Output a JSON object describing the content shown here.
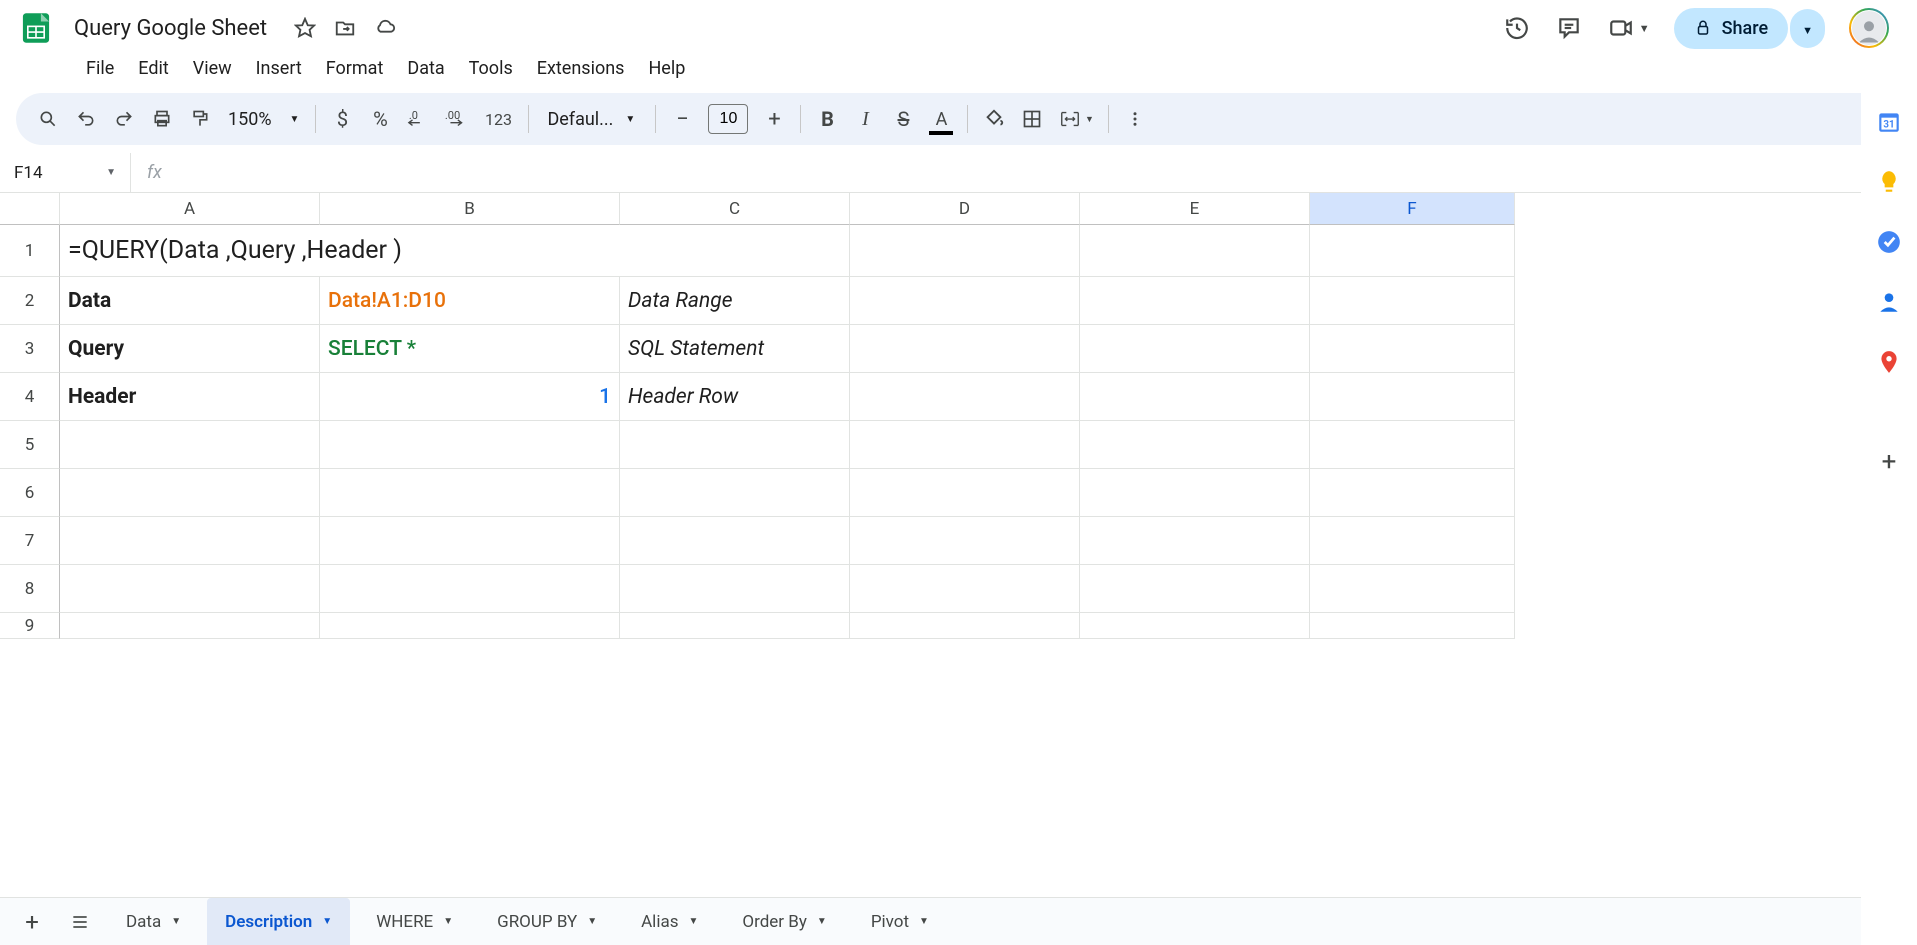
{
  "doc": {
    "title": "Query Google Sheet"
  },
  "menu": [
    "File",
    "Edit",
    "View",
    "Insert",
    "Format",
    "Data",
    "Tools",
    "Extensions",
    "Help"
  ],
  "toolbar": {
    "zoom": "150%",
    "font": "Defaul...",
    "font_size": "10",
    "number_format_123": "123"
  },
  "name_box": "F14",
  "formula_bar": "",
  "columns": [
    "A",
    "B",
    "C",
    "D",
    "E",
    "F"
  ],
  "selected_column": "F",
  "rows": [
    "1",
    "2",
    "3",
    "4",
    "5",
    "6",
    "7",
    "8",
    "9"
  ],
  "cells": {
    "A1": "=QUERY(Data ,Query ,Header )",
    "A2": "Data",
    "B2": "Data!A1:D10",
    "C2": "Data Range",
    "A3": "Query",
    "B3": "SELECT *",
    "C3": "SQL Statement",
    "A4": "Header",
    "B4": "1",
    "C4": "Header Row"
  },
  "sheets": [
    {
      "name": "Data",
      "active": false
    },
    {
      "name": "Description",
      "active": true
    },
    {
      "name": "WHERE",
      "active": false
    },
    {
      "name": "GROUP BY",
      "active": false
    },
    {
      "name": "Alias",
      "active": false
    },
    {
      "name": "Order By",
      "active": false
    },
    {
      "name": "Pivot",
      "active": false
    }
  ],
  "share_label": "Share",
  "side_apps": [
    "calendar",
    "keep",
    "tasks",
    "contacts",
    "maps"
  ]
}
